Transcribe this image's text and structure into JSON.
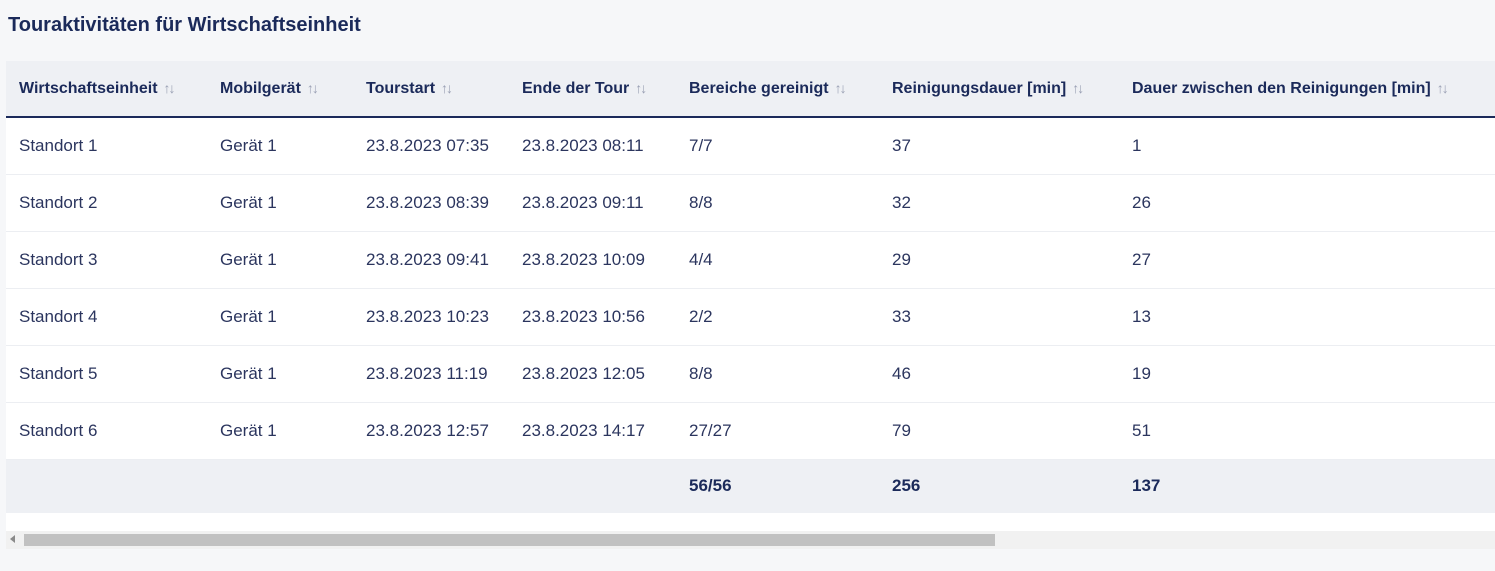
{
  "page": {
    "title": "Touraktivitäten für Wirtschaftseinheit"
  },
  "table": {
    "columns": [
      {
        "label": "Wirtschaftseinheit",
        "sort_icon": "↑↓"
      },
      {
        "label": "Mobilgerät",
        "sort_icon": "↑↓"
      },
      {
        "label": "Tourstart",
        "sort_icon": "↑↓"
      },
      {
        "label": "Ende der Tour",
        "sort_icon": "↑↓"
      },
      {
        "label": "Bereiche gereinigt",
        "sort_icon": "↑↓"
      },
      {
        "label": "Reinigungsdauer [min]",
        "sort_icon": "↑↓"
      },
      {
        "label": "Dauer zwischen den Reinigungen [min]",
        "sort_icon": "↑↓"
      }
    ],
    "rows": [
      [
        "Standort 1",
        "Gerät 1",
        "23.8.2023 07:35",
        "23.8.2023 08:11",
        "7/7",
        "37",
        "1"
      ],
      [
        "Standort 2",
        "Gerät 1",
        "23.8.2023 08:39",
        "23.8.2023 09:11",
        "8/8",
        "32",
        "26"
      ],
      [
        "Standort 3",
        "Gerät 1",
        "23.8.2023 09:41",
        "23.8.2023 10:09",
        "4/4",
        "29",
        "27"
      ],
      [
        "Standort 4",
        "Gerät 1",
        "23.8.2023 10:23",
        "23.8.2023 10:56",
        "2/2",
        "33",
        "13"
      ],
      [
        "Standort 5",
        "Gerät 1",
        "23.8.2023 11:19",
        "23.8.2023 12:05",
        "8/8",
        "46",
        "19"
      ],
      [
        "Standort 6",
        "Gerät 1",
        "23.8.2023 12:57",
        "23.8.2023 14:17",
        "27/27",
        "79",
        "51"
      ]
    ],
    "totals": [
      "",
      "",
      "",
      "",
      "56/56",
      "256",
      "137"
    ]
  },
  "colors": {
    "header_bg": "#eef0f4",
    "title_text": "#1b2a5a",
    "body_text": "#2b355e",
    "page_bg": "#f6f7f9"
  },
  "scrollbar": {
    "horizontal_position": 0
  }
}
